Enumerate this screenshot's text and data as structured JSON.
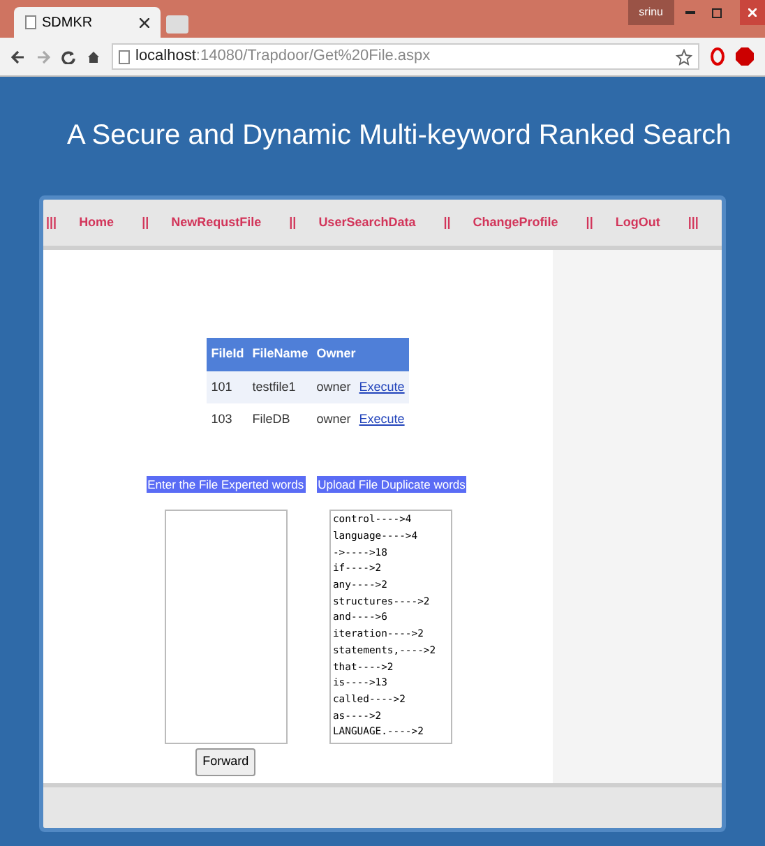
{
  "browser": {
    "tab_title": "SDMKR",
    "user": "srinu",
    "url_host": "localhost",
    "url_path": ":14080/Trapdoor/Get%20File.aspx"
  },
  "page": {
    "heading": "A Secure and Dynamic Multi-keyword Ranked Search",
    "nav": [
      {
        "label": "Home"
      },
      {
        "label": "NewRequstFile"
      },
      {
        "label": "UserSearchData"
      },
      {
        "label": "ChangeProfile"
      },
      {
        "label": "LogOut"
      }
    ],
    "nav_lead": "|||",
    "nav_separator": "||",
    "nav_end": "|||",
    "table": {
      "columns": [
        "FileId",
        "FileName",
        "Owner"
      ],
      "rows": [
        {
          "cells": [
            "101",
            "testfile1",
            "owner"
          ],
          "action": "Execute"
        },
        {
          "cells": [
            "103",
            "FileDB",
            "owner"
          ],
          "action": "Execute"
        }
      ]
    },
    "expected_label": "Enter the File Experted words",
    "duplicate_label": "Upload File Duplicate words",
    "duplicate_words": [
      "control---->4",
      "language---->4",
      "->---->18",
      "if---->2",
      "any---->2",
      "structures---->2",
      "and---->6",
      "iteration---->2",
      "statements,---->2",
      "that---->2",
      "is---->13",
      "called---->2",
      "as---->2",
      "LANGUAGE.---->2"
    ],
    "forward_button": "Forward"
  }
}
